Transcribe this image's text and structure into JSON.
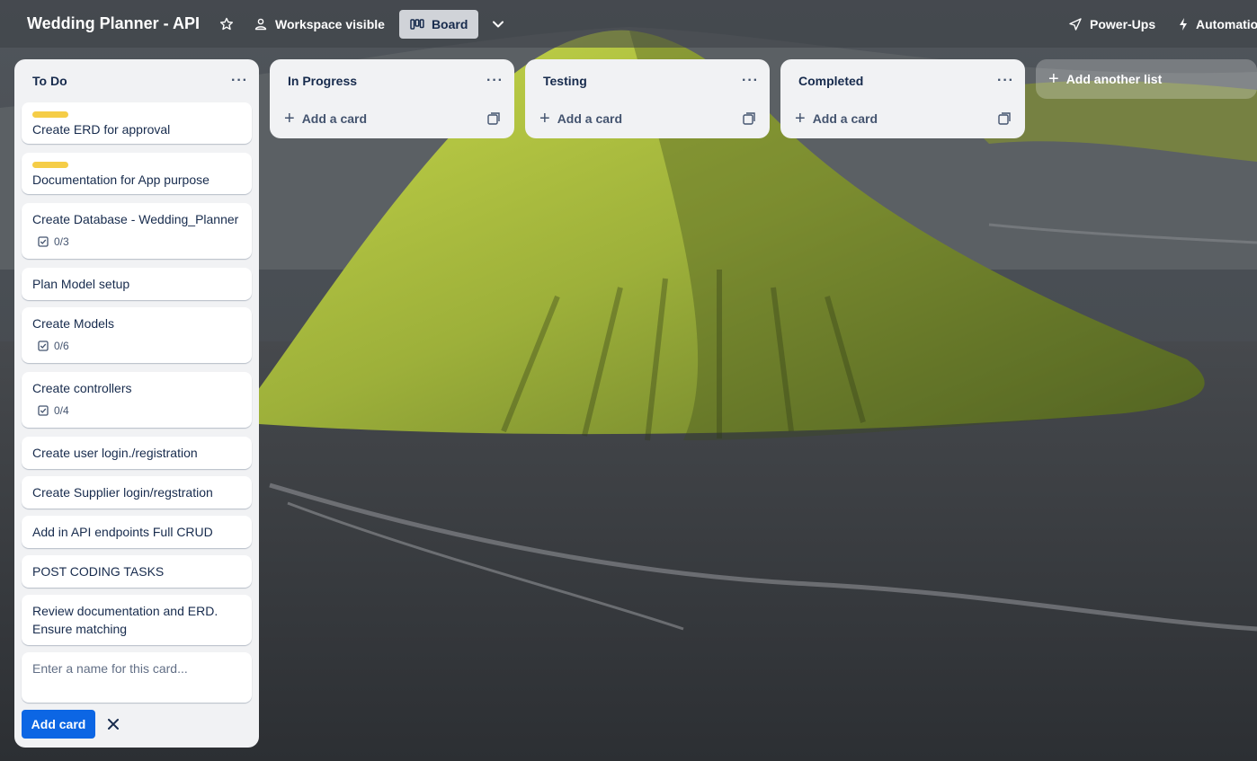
{
  "header": {
    "board_title": "Wedding Planner - API",
    "visibility_label": "Workspace visible",
    "view_label": "Board",
    "powerups_label": "Power-Ups",
    "automation_label": "Automatio"
  },
  "lists": [
    {
      "title": "To Do",
      "cards": [
        {
          "text": "Create ERD for approval",
          "label_color": "#f5cd47"
        },
        {
          "text": "Documentation for App purpose",
          "label_color": "#f5cd47"
        },
        {
          "text": "Create Database - Wedding_Planner",
          "checklist": "0/3"
        },
        {
          "text": "Plan Model setup"
        },
        {
          "text": "Create Models",
          "checklist": "0/6"
        },
        {
          "text": "Create controllers",
          "checklist": "0/4"
        },
        {
          "text": "Create user login./registration"
        },
        {
          "text": "Create Supplier login/regstration"
        },
        {
          "text": "Add in API endpoints Full CRUD"
        },
        {
          "text": "POST CODING TASKS"
        },
        {
          "text": "Review documentation and ERD.",
          "text2": "Ensure matching"
        }
      ],
      "composer_placeholder": "Enter a name for this card...",
      "add_card_button": "Add card"
    },
    {
      "title": "In Progress",
      "add_card_label": "Add a card"
    },
    {
      "title": "Testing",
      "add_card_label": "Add a card"
    },
    {
      "title": "Completed",
      "add_card_label": "Add a card"
    }
  ],
  "list_menu_glyph": "···",
  "add_list_label": "Add another list",
  "colors": {
    "accent": "#0c66e4",
    "label_yellow": "#f5cd47",
    "list_bg": "#f1f2f4",
    "text_dark": "#172b4d"
  }
}
